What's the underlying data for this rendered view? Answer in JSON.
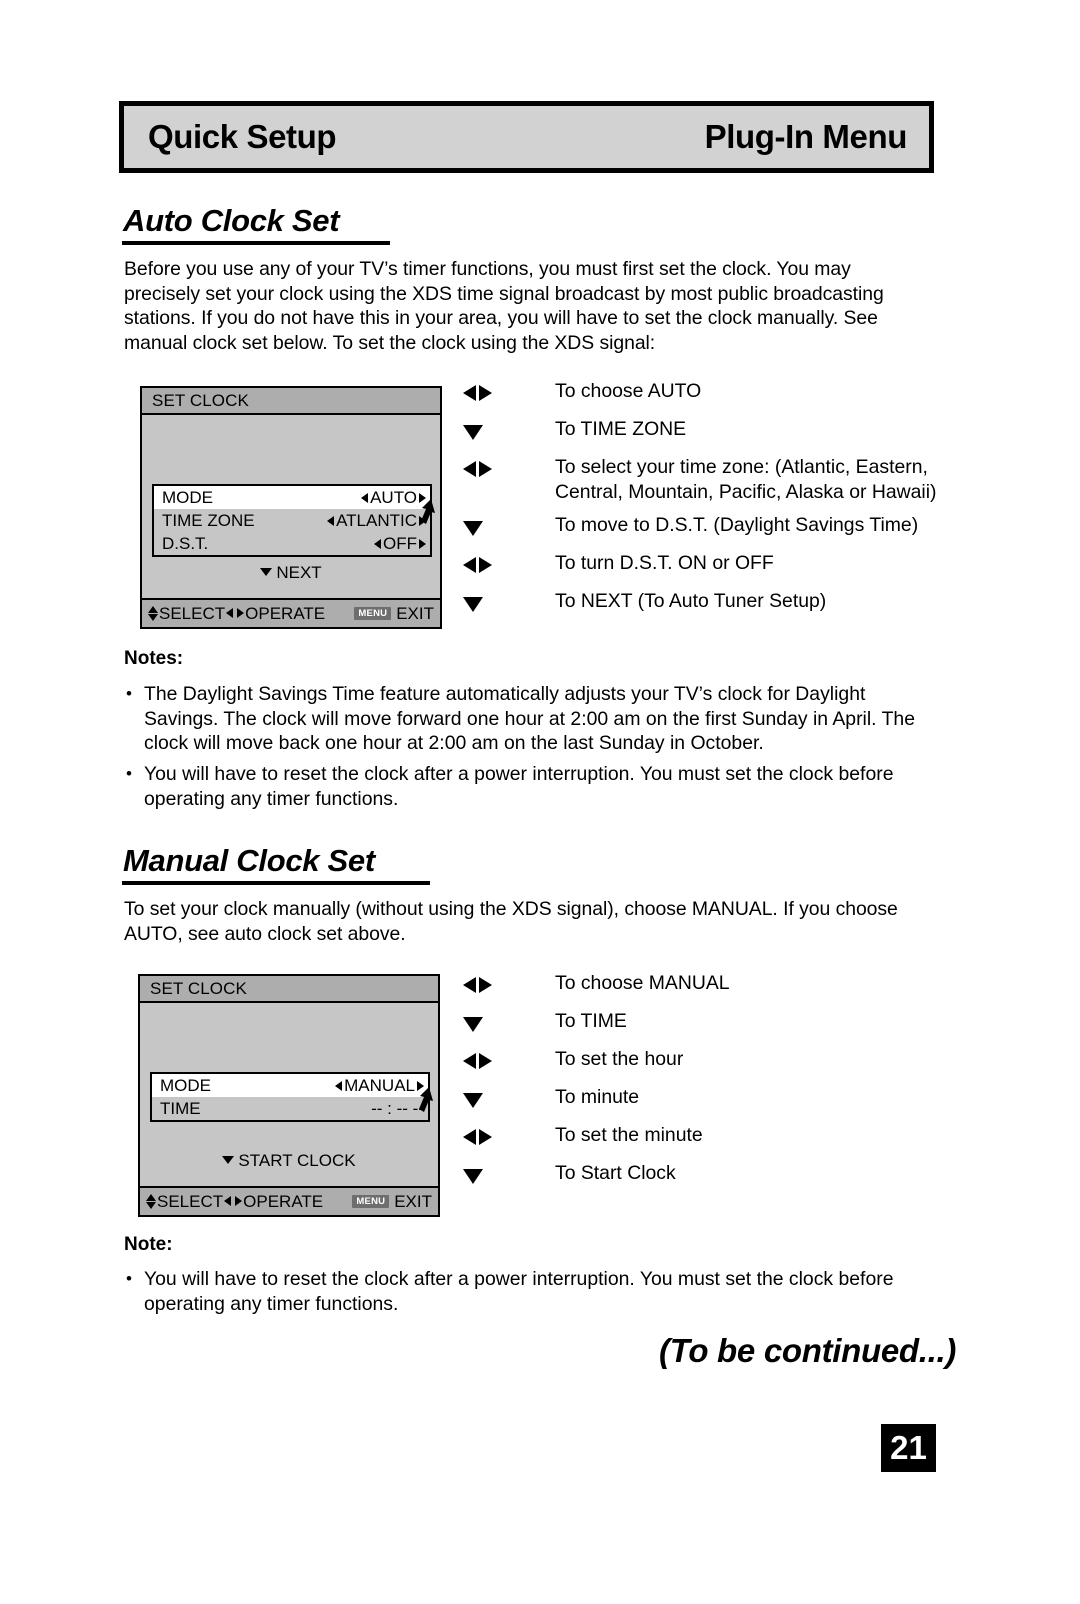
{
  "header": {
    "left_title": "Quick Setup",
    "right_title": "Plug-In Menu"
  },
  "auto_section": {
    "heading": "Auto Clock Set",
    "intro": "Before you use any of your TV’s timer functions, you must first set the clock. You may precisely set your clock using the XDS time signal broadcast by most public broadcasting stations. If you do not have this in your area, you will have to set the clock manually. See manual clock set below. To set the clock using the XDS signal:",
    "osd": {
      "title": "SET CLOCK",
      "rows": [
        {
          "label": "MODE",
          "value": "AUTO",
          "has_arrows": true,
          "highlight": true
        },
        {
          "label": "TIME ZONE",
          "value": "ATLANTIC",
          "has_arrows": true,
          "highlight": false
        },
        {
          "label": "D.S.T.",
          "value": "OFF",
          "has_arrows": true,
          "highlight": false
        }
      ],
      "next_label": "NEXT",
      "footer": {
        "select_label": "SELECT",
        "operate_label": "OPERATE",
        "menu_chip": "MENU",
        "exit_label": "EXIT"
      }
    },
    "instructions": [
      {
        "key": "left-right",
        "text": "To choose AUTO"
      },
      {
        "key": "down",
        "text": "To TIME ZONE"
      },
      {
        "key": "left-right",
        "text": "To select your time zone: (Atlantic, Eastern, Central, Mountain, Pacific, Alaska or Hawaii)"
      },
      {
        "key": "down",
        "text": "To move to D.S.T. (Daylight Savings Time)"
      },
      {
        "key": "left-right",
        "text": "To turn D.S.T. ON or OFF"
      },
      {
        "key": "down",
        "text": "To NEXT (To Auto Tuner Setup)"
      }
    ],
    "notes_label": "Notes:",
    "notes": [
      "The Daylight Savings Time feature automatically adjusts your TV’s clock for Daylight Savings. The clock will move forward one hour at 2:00 am on the first Sunday in April. The clock will move back one hour at 2:00 am on the last Sunday in October.",
      "You will have to reset the clock after a power interruption. You must set the clock before operating any timer functions."
    ]
  },
  "manual_section": {
    "heading": "Manual Clock Set",
    "intro": "To set your clock manually (without using the XDS signal), choose MANUAL. If you choose AUTO, see auto clock set above.",
    "osd": {
      "title": "SET CLOCK",
      "rows": [
        {
          "label": "MODE",
          "value": "MANUAL",
          "has_arrows": true,
          "highlight": true
        },
        {
          "label": "TIME",
          "value": "-- : -- --",
          "has_arrows": false,
          "highlight": false
        }
      ],
      "next_label": "START CLOCK",
      "footer": {
        "select_label": "SELECT",
        "operate_label": "OPERATE",
        "menu_chip": "MENU",
        "exit_label": "EXIT"
      }
    },
    "instructions": [
      {
        "key": "left-right",
        "text": "To choose MANUAL"
      },
      {
        "key": "down",
        "text": "To TIME"
      },
      {
        "key": "left-right",
        "text": "To set the hour"
      },
      {
        "key": "down",
        "text": "To minute"
      },
      {
        "key": "left-right",
        "text": "To set the minute"
      },
      {
        "key": "down",
        "text": "To Start Clock"
      }
    ],
    "notes_label": "Note:",
    "notes": [
      "You will have to reset the clock after a power interruption. You must set the clock before operating any timer functions."
    ]
  },
  "footer": {
    "to_be_continued": "(To be continued...)",
    "page_number": "21"
  },
  "bullet_glyph": "•",
  "colors": {
    "banner_fill": "#d2d2d2",
    "osd_body": "#c6c6c6",
    "osd_title_bar": "#adadad",
    "highlight_row": "#ffffff",
    "menu_chip": "#6e6e6e",
    "ink": "#000000"
  }
}
